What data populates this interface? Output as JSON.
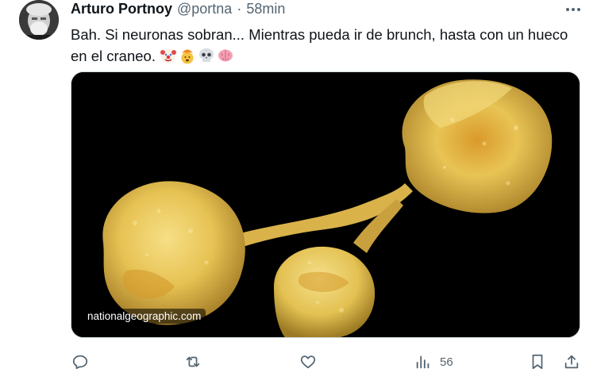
{
  "tweet": {
    "display_name": "Arturo Portnoy",
    "handle": "@portna",
    "separator": "·",
    "time": "58min",
    "text": "Bah. Si neuronas sobran... Mientras pueda ir de brunch, hasta con un hueco en el craneo.",
    "emojis": [
      "clown-face",
      "exploding-head",
      "skull",
      "brain"
    ],
    "media_source": "nationalgeographic.com"
  },
  "actions": {
    "views_count": "56"
  },
  "icons": {
    "more": "more-icon",
    "reply": "reply-icon",
    "retweet": "retweet-icon",
    "like": "like-icon",
    "views": "views-icon",
    "bookmark": "bookmark-icon",
    "share": "share-icon"
  },
  "colors": {
    "text": "#0f1419",
    "secondary": "#536471",
    "cell": "#e9c65a"
  }
}
